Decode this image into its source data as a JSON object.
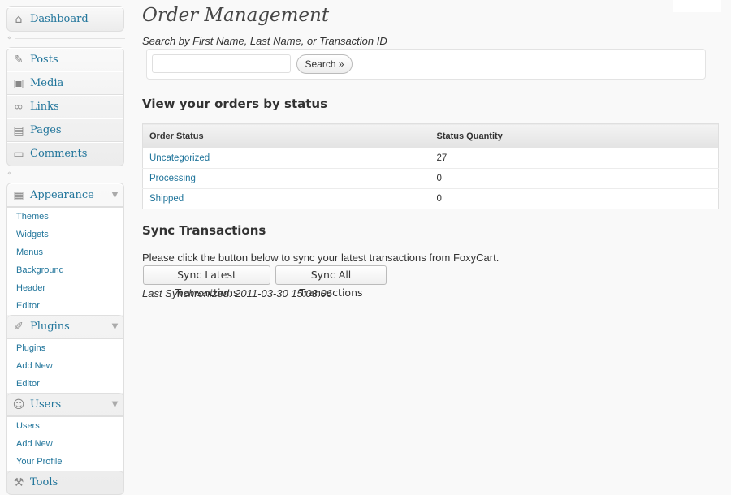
{
  "sidebar": {
    "dashboard": {
      "label": "Dashboard",
      "icon": "dashboard-icon"
    },
    "posts": {
      "label": "Posts",
      "icon": "pushpin-icon"
    },
    "media": {
      "label": "Media",
      "icon": "media-icon"
    },
    "links": {
      "label": "Links",
      "icon": "link-icon"
    },
    "pages": {
      "label": "Pages",
      "icon": "pages-icon"
    },
    "comments": {
      "label": "Comments",
      "icon": "comment-icon"
    },
    "appearance": {
      "label": "Appearance",
      "icon": "appearance-icon",
      "items": [
        "Themes",
        "Widgets",
        "Menus",
        "Background",
        "Header",
        "Editor"
      ]
    },
    "plugins": {
      "label": "Plugins",
      "icon": "plugin-icon",
      "items": [
        "Plugins",
        "Add New",
        "Editor"
      ]
    },
    "users": {
      "label": "Users",
      "icon": "users-icon",
      "items": [
        "Users",
        "Add New",
        "Your Profile"
      ]
    },
    "tools": {
      "label": "Tools",
      "icon": "tools-icon"
    }
  },
  "main": {
    "title": "Order Management",
    "search_label": "Search by First Name, Last Name, or Transaction ID",
    "search_value": "",
    "search_button": "Search »",
    "status_heading": "View your orders by status",
    "table": {
      "headers": [
        "Order Status",
        "Status Quantity"
      ],
      "rows": [
        {
          "status": "Uncategorized",
          "qty": "27"
        },
        {
          "status": "Processing",
          "qty": "0"
        },
        {
          "status": "Shipped",
          "qty": "0"
        }
      ]
    },
    "sync_heading": "Sync Transactions",
    "sync_text": "Please click the button below to sync your latest transactions from FoxyCart.",
    "sync_latest_button": "Sync Latest Transactions",
    "sync_all_button": "Sync All Transactions",
    "last_synced": "Last Synchronized: 2011-03-30 15:03:06"
  }
}
